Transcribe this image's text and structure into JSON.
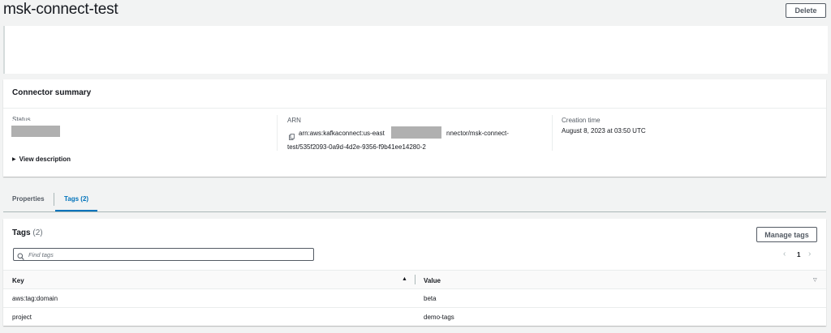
{
  "header": {
    "title": "msk-connect-test",
    "delete_label": "Delete"
  },
  "summary": {
    "title": "Connector summary",
    "status_label": "Status",
    "view_description": "View description",
    "arn_label": "ARN",
    "arn_part1": "arn:aws:kafkaconnect:us-east",
    "arn_part2": "nnector/msk-connect-",
    "arn_part3": "test/535f2093-0a9d-4d2e-9356-f9b41ee14280-2",
    "creation_label": "Creation time",
    "creation_value": "August 8, 2023 at 03:50 UTC"
  },
  "tabs": [
    {
      "label": "Properties",
      "active": false
    },
    {
      "label": "Tags (2)",
      "active": true
    }
  ],
  "tags_panel": {
    "title": "Tags",
    "count": "(2)",
    "manage_label": "Manage tags",
    "search_placeholder": "Find tags",
    "page_number": "1",
    "columns": {
      "key": "Key",
      "value": "Value"
    },
    "rows": [
      {
        "key": "aws:tag:domain",
        "value": "beta"
      },
      {
        "key": "project",
        "value": "demo-tags"
      }
    ]
  }
}
